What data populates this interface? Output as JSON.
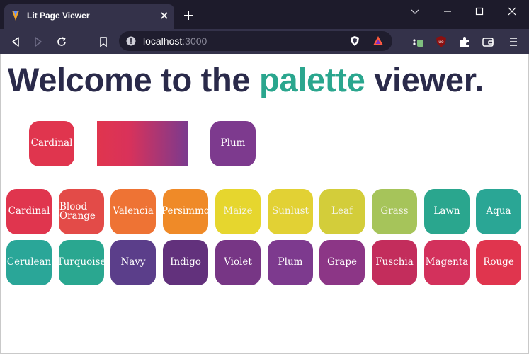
{
  "browser": {
    "tab_title": "Lit Page Viewer",
    "url_host": "localhost",
    "url_port": ":3000"
  },
  "page": {
    "headline_before": "Welcome to the ",
    "headline_accent": "palette",
    "headline_after": " viewer."
  },
  "featured": [
    {
      "name": "Cardinal",
      "color": "#e0354e"
    },
    {
      "name": "",
      "gradient": [
        "#e0354e",
        "#7b3a8e"
      ]
    },
    {
      "name": "Plum",
      "color": "#7d3a8e"
    }
  ],
  "palette_rows": [
    [
      {
        "name": "Cardinal",
        "color": "#e0354e"
      },
      {
        "name": "Blood Orange",
        "color": "#e34b48"
      },
      {
        "name": "Valencia",
        "color": "#ee7334"
      },
      {
        "name": "Persimmo",
        "color": "#ef8a28"
      },
      {
        "name": "Maize",
        "color": "#e6d62e"
      },
      {
        "name": "Sunlust",
        "color": "#e2d134"
      },
      {
        "name": "Leaf",
        "color": "#d3cd3a"
      },
      {
        "name": "Grass",
        "color": "#a6c45a"
      },
      {
        "name": "Lawn",
        "color": "#2aa68e"
      },
      {
        "name": "Aqua",
        "color": "#2aa695"
      }
    ],
    [
      {
        "name": "Cerulean",
        "color": "#2aa698"
      },
      {
        "name": "Turquoise",
        "color": "#2aa790"
      },
      {
        "name": "Navy",
        "color": "#5b3e8a"
      },
      {
        "name": "Indigo",
        "color": "#62317c"
      },
      {
        "name": "Violet",
        "color": "#773685"
      },
      {
        "name": "Plum",
        "color": "#7d3a8e"
      },
      {
        "name": "Grape",
        "color": "#8c3686"
      },
      {
        "name": "Fuschia",
        "color": "#c32d5c"
      },
      {
        "name": "Magenta",
        "color": "#d3315c"
      },
      {
        "name": "Rouge",
        "color": "#e0354e"
      }
    ]
  ]
}
